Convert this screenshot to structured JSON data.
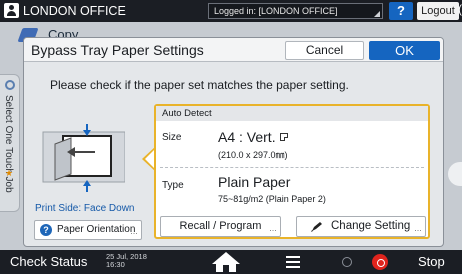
{
  "topbar": {
    "office": "LONDON OFFICE",
    "login_status": "Logged in: [LONDON OFFICE]",
    "help": "?",
    "logout": "Logout",
    "edge_glyph": "("
  },
  "background": {
    "app_title": "Copy",
    "side_tab": "Select One Touch Job"
  },
  "dialog": {
    "title": "Bypass Tray Paper Settings",
    "cancel": "Cancel",
    "ok": "OK",
    "instruction": "Please check if the paper set matches the paper setting.",
    "print_side": "Print Side: Face Down",
    "paper_orientation": "Paper Orientation",
    "panel": {
      "header": "Auto Detect",
      "size_label": "Size",
      "size_value": "A4 : Vert.",
      "size_sub": "(210.0 x 297.0㎜)",
      "type_label": "Type",
      "type_value": "Plain Paper",
      "type_sub": "75~81g/m2 (Plain Paper 2)",
      "recall": "Recall / Program",
      "change": "Change Setting"
    }
  },
  "bottombar": {
    "check_status": "Check Status",
    "date": "25 Jul, 2018",
    "time": "16:30",
    "stop": "Stop"
  },
  "colors": {
    "accent": "#1565c0",
    "panel_border": "#e9b32a",
    "stop": "#e0241d"
  },
  "icons": [
    "user-icon",
    "help-icon",
    "copy-icon",
    "pencil-icon",
    "question-icon",
    "home-icon",
    "menu-icon",
    "power-icon",
    "stop-icon",
    "paper-orientation-icon"
  ]
}
